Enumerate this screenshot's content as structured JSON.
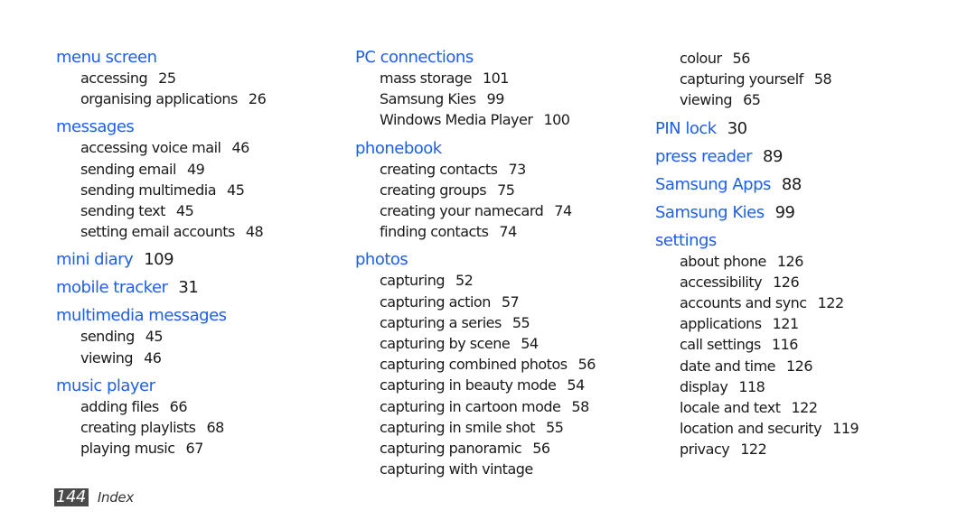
{
  "columns": [
    {
      "entries": [
        {
          "heading": "menu screen",
          "page": "",
          "subs": [
            {
              "text": "accessing",
              "page": "25"
            },
            {
              "text": "organising applications",
              "page": "26"
            }
          ]
        },
        {
          "heading": "messages",
          "page": "",
          "subs": [
            {
              "text": "accessing voice mail",
              "page": "46"
            },
            {
              "text": "sending email",
              "page": "49"
            },
            {
              "text": "sending multimedia",
              "page": "45"
            },
            {
              "text": "sending text",
              "page": "45"
            },
            {
              "text": "setting email accounts",
              "page": "48"
            }
          ]
        },
        {
          "heading": "mini diary",
          "page": "109",
          "subs": []
        },
        {
          "heading": "mobile tracker",
          "page": "31",
          "subs": []
        },
        {
          "heading": "multimedia messages",
          "page": "",
          "subs": [
            {
              "text": "sending",
              "page": "45"
            },
            {
              "text": "viewing",
              "page": "46"
            }
          ]
        },
        {
          "heading": "music player",
          "page": "",
          "subs": [
            {
              "text": "adding files",
              "page": "66"
            },
            {
              "text": "creating playlists",
              "page": "68"
            },
            {
              "text": "playing music",
              "page": "67"
            }
          ]
        }
      ]
    },
    {
      "entries": [
        {
          "heading": "PC connections",
          "page": "",
          "subs": [
            {
              "text": "mass storage",
              "page": "101"
            },
            {
              "text": "Samsung Kies",
              "page": "99"
            },
            {
              "text": "Windows Media Player",
              "page": "100"
            }
          ]
        },
        {
          "heading": "phonebook",
          "page": "",
          "subs": [
            {
              "text": "creating contacts",
              "page": "73"
            },
            {
              "text": "creating groups",
              "page": "75"
            },
            {
              "text": "creating your namecard",
              "page": "74"
            },
            {
              "text": "finding contacts",
              "page": "74"
            }
          ]
        },
        {
          "heading": "photos",
          "page": "",
          "subs": [
            {
              "text": "capturing",
              "page": "52"
            },
            {
              "text": "capturing action",
              "page": "57"
            },
            {
              "text": "capturing a series",
              "page": "55"
            },
            {
              "text": "capturing by scene",
              "page": "54"
            },
            {
              "text": "capturing combined photos",
              "page": "56"
            },
            {
              "text": "capturing in beauty mode",
              "page": "54"
            },
            {
              "text": "capturing in cartoon mode",
              "page": "58"
            },
            {
              "text": "capturing in smile shot",
              "page": "55"
            },
            {
              "text": "capturing panoramic",
              "page": "56"
            },
            {
              "text": "capturing with vintage",
              "page": ""
            }
          ]
        }
      ]
    },
    {
      "continued": [
        {
          "text": "colour",
          "page": "56"
        },
        {
          "text": "capturing yourself",
          "page": "58"
        },
        {
          "text": "viewing",
          "page": "65"
        }
      ],
      "entries": [
        {
          "heading": "PIN lock",
          "page": "30",
          "subs": []
        },
        {
          "heading": "press reader",
          "page": "89",
          "subs": []
        },
        {
          "heading": "Samsung Apps",
          "page": "88",
          "subs": []
        },
        {
          "heading": "Samsung Kies",
          "page": "99",
          "subs": []
        },
        {
          "heading": "settings",
          "page": "",
          "subs": [
            {
              "text": "about phone",
              "page": "126"
            },
            {
              "text": "accessibility",
              "page": "126"
            },
            {
              "text": "accounts and sync",
              "page": "122"
            },
            {
              "text": "applications",
              "page": "121"
            },
            {
              "text": "call settings",
              "page": "116"
            },
            {
              "text": "date and time",
              "page": "126"
            },
            {
              "text": "display",
              "page": "118"
            },
            {
              "text": "locale and text",
              "page": "122"
            },
            {
              "text": "location and security",
              "page": "119"
            },
            {
              "text": "privacy",
              "page": "122"
            }
          ]
        }
      ]
    }
  ],
  "footer": {
    "page_number": "144",
    "section": "Index"
  },
  "colors": {
    "heading": "#1f5fe8",
    "text": "#1a1a1a",
    "page_badge_bg": "#4a4a4a"
  }
}
